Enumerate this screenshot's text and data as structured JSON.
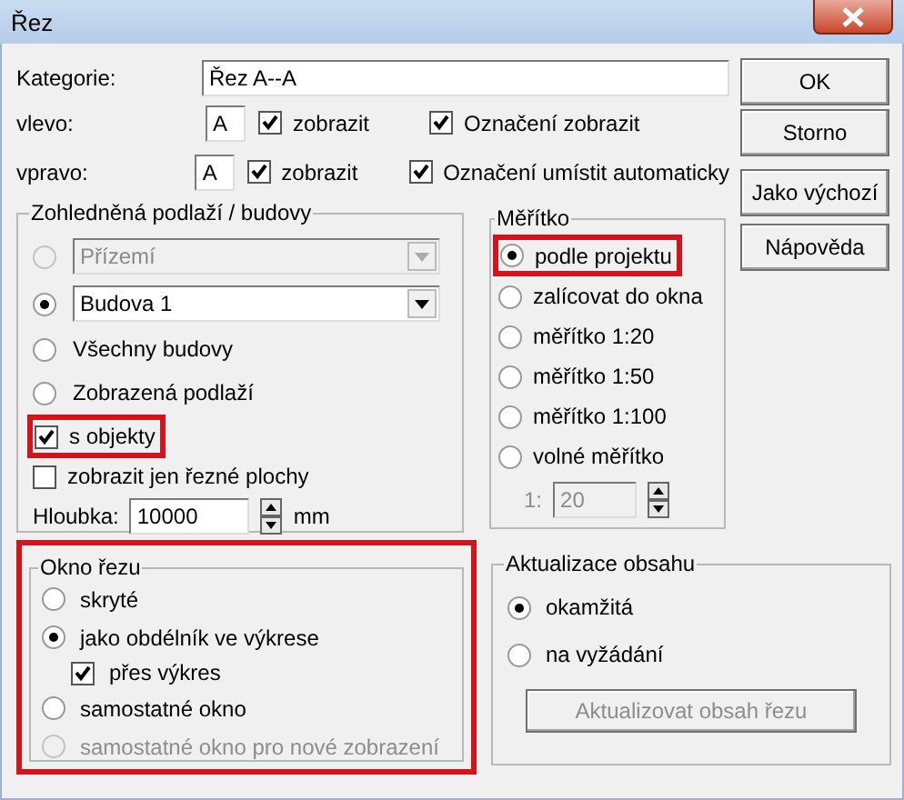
{
  "window": {
    "title": "Řez"
  },
  "category": {
    "label": "Kategorie:",
    "value": "Řez A--A"
  },
  "sides": [
    {
      "label": "vlevo:",
      "value": "A",
      "show": {
        "label": "zobrazit",
        "checked": true
      },
      "marker": {
        "label": "Označení zobrazit",
        "checked": true
      }
    },
    {
      "label": "vpravo:",
      "value": "A",
      "show": {
        "label": "zobrazit",
        "checked": true
      },
      "marker": {
        "label": "Označení umístit automaticky",
        "checked": true
      }
    }
  ],
  "buttons": [
    "OK",
    "Storno",
    "Jako výchozí",
    "Nápověda"
  ],
  "floors_group": {
    "title": "Zohledněná podlaží / budovy",
    "options": [
      {
        "kind": "combo",
        "value": "Přízemí",
        "selected": false,
        "disabled": true
      },
      {
        "kind": "combo",
        "value": "Budova 1",
        "selected": true,
        "disabled": false
      },
      {
        "kind": "radio",
        "label": "Všechny budovy",
        "selected": false,
        "disabled": false
      },
      {
        "kind": "radio",
        "label": "Zobrazená podlaží",
        "selected": false,
        "disabled": false
      }
    ],
    "checks": [
      {
        "label": "s objekty",
        "checked": true,
        "highlighted": true
      },
      {
        "label": "zobrazit jen řezné plochy",
        "checked": false,
        "highlighted": false
      }
    ],
    "depth": {
      "label": "Hloubka:",
      "value": "10000",
      "unit": "mm"
    }
  },
  "scale_group": {
    "title": "Měřítko",
    "options": [
      {
        "label": "podle projektu",
        "selected": true,
        "highlighted": true
      },
      {
        "label": "zalícovat do okna",
        "selected": false,
        "highlighted": false
      },
      {
        "label": "měřítko 1:20",
        "selected": false,
        "highlighted": false
      },
      {
        "label": "měřítko 1:50",
        "selected": false,
        "highlighted": false
      },
      {
        "label": "měřítko 1:100",
        "selected": false,
        "highlighted": false
      },
      {
        "label": "volné měřítko",
        "selected": false,
        "highlighted": false
      }
    ],
    "custom": {
      "label": "1:",
      "value": "20",
      "disabled": true
    }
  },
  "window_group": {
    "title": "Okno řezu",
    "highlighted": true,
    "items": [
      {
        "kind": "radio",
        "label": "skryté",
        "selected": false,
        "disabled": false
      },
      {
        "kind": "radio",
        "label": "jako obdélník ve výkrese",
        "selected": true,
        "disabled": false
      },
      {
        "kind": "check",
        "label": "přes výkres",
        "checked": true,
        "disabled": false
      },
      {
        "kind": "radio",
        "label": "samostatné okno",
        "selected": false,
        "disabled": false
      },
      {
        "kind": "radio",
        "label": "samostatné okno pro nové zobrazení",
        "selected": false,
        "disabled": true
      }
    ]
  },
  "update_group": {
    "title": "Aktualizace obsahu",
    "options": [
      {
        "label": "okamžitá",
        "selected": true
      },
      {
        "label": "na vyžádání",
        "selected": false
      }
    ],
    "button": {
      "label": "Aktualizovat obsah řezu",
      "disabled": true
    }
  }
}
